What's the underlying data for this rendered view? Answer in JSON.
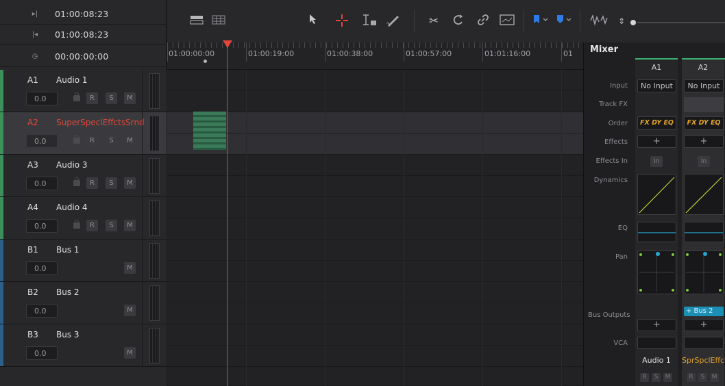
{
  "timecodes": [
    {
      "icon": "next-edit-icon",
      "value": "01:00:08:23"
    },
    {
      "icon": "prev-edit-icon",
      "value": "01:00:08:23"
    },
    {
      "icon": "clock-icon",
      "value": "00:00:00:00"
    }
  ],
  "tracks": [
    {
      "id": "A1",
      "name": "Audio 1",
      "volume": "0.0",
      "type": "audio",
      "selected": false
    },
    {
      "id": "A2",
      "name": "SuperSpeclEffctsSrnd",
      "volume": "0.0",
      "type": "audio",
      "selected": true
    },
    {
      "id": "A3",
      "name": "Audio 3",
      "volume": "0.0",
      "type": "audio",
      "selected": false
    },
    {
      "id": "A4",
      "name": "Audio 4",
      "volume": "0.0",
      "type": "audio",
      "selected": false
    },
    {
      "id": "B1",
      "name": "Bus 1",
      "volume": "0.0",
      "type": "bus",
      "selected": false
    },
    {
      "id": "B2",
      "name": "Bus 2",
      "volume": "0.0",
      "type": "bus",
      "selected": false
    },
    {
      "id": "B3",
      "name": "Bus 3",
      "volume": "0.0",
      "type": "bus",
      "selected": false
    }
  ],
  "track_buttons": {
    "record": "R",
    "solo": "S",
    "mute": "M"
  },
  "ruler": {
    "labels": [
      "01:00:00:00",
      "01:00:19:00",
      "01:00:38:00",
      "01:00:57:00",
      "01:01:16:00",
      "01"
    ]
  },
  "toolbar": {
    "icons": [
      "layout-icon",
      "grid-layout-icon",
      "pointer-icon",
      "range-select-icon",
      "trim-icon",
      "pen-icon",
      "razor-icon",
      "snap-icon",
      "link-icon",
      "clip-replace-icon",
      "flag-icon",
      "marker-icon",
      "waveform-icon",
      "zoom-icon"
    ]
  },
  "mixer": {
    "title": "Mixer",
    "row_labels": {
      "input": "Input",
      "track_fx": "Track FX",
      "order": "Order",
      "effects": "Effects",
      "effects_in": "Effects In",
      "dynamics": "Dynamics",
      "eq": "EQ",
      "pan": "Pan",
      "bus_outputs": "Bus Outputs",
      "vca": "VCA"
    },
    "channels": [
      {
        "name": "A1",
        "input": "No Input",
        "order": "FX DY EQ",
        "effects": "+",
        "effects_in": "In",
        "bus_out": "",
        "bus_plus": "+",
        "label": "Audio 1",
        "rsm": [
          "R",
          "S",
          "M"
        ]
      },
      {
        "name": "A2",
        "input": "No Input",
        "order": "FX DY EQ",
        "effects": "+",
        "effects_in": "In",
        "bus_out": "+ Bus 2",
        "bus_plus": "+",
        "label": "SprSpclEffctS",
        "rsm": [
          "R",
          "S",
          "M"
        ]
      }
    ],
    "colors": {
      "accent": "#3db06e",
      "dynamics_line": "#b6d63a",
      "eq_line": "#27a6d1",
      "pan_dot": "#27a6d1",
      "pan_corner": "#7cc83d",
      "a2_label": "#e0a22a",
      "bus_out": "#1c8fb4"
    }
  },
  "colors": {
    "audio_track": "#3d8f5c",
    "bus_track": "#2c5f8a",
    "selected_track": "#e2453a",
    "playhead": "#e2453a",
    "clip": "#3a7a58"
  }
}
